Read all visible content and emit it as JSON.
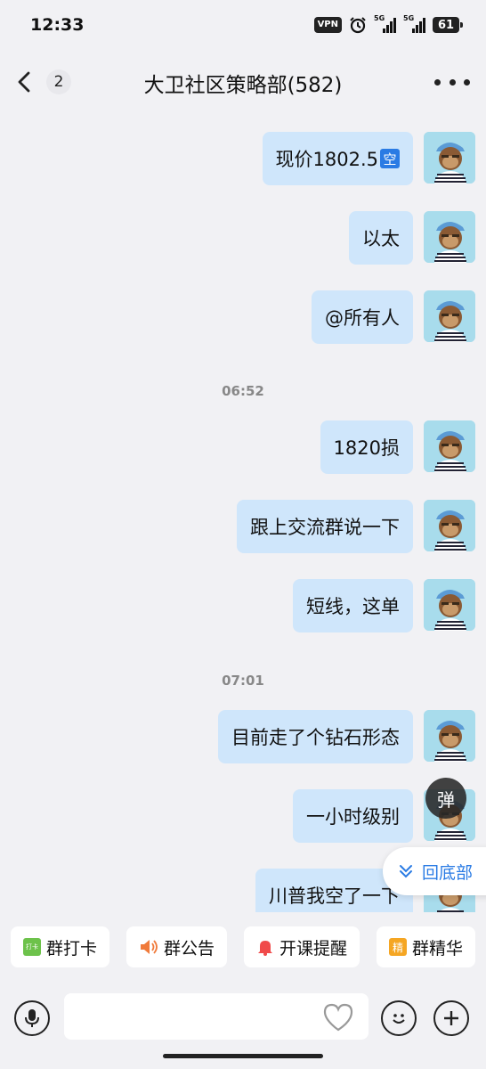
{
  "status": {
    "time": "12:33",
    "vpn": "VPN",
    "net1": "5G",
    "net2": "5G",
    "battery": "61"
  },
  "header": {
    "unread": "2",
    "title": "大卫社区策略部(582)"
  },
  "messages": [
    {
      "text": "现价1802.5",
      "tag": "空"
    },
    {
      "text": "以太"
    },
    {
      "text": "@所有人"
    },
    {
      "text": "1820损"
    },
    {
      "text": "跟上交流群说一下"
    },
    {
      "text": "短线，这单"
    },
    {
      "text": "目前走了个钻石形态"
    },
    {
      "text": "一小时级别"
    },
    {
      "text": "川普我空了一下"
    }
  ],
  "time_separators": [
    "06:52",
    "07:01"
  ],
  "floating": {
    "dan": "弹",
    "to_bottom": "回底部"
  },
  "quick_actions": [
    {
      "label": "群打卡",
      "icon": "打卡",
      "color": "#6dc24b"
    },
    {
      "label": "群公告",
      "icon": "",
      "color": "#f07a3a"
    },
    {
      "label": "开课提醒",
      "icon": "",
      "color": "#f04a4a"
    },
    {
      "label": "群精华",
      "icon": "精",
      "color": "#f5a623"
    }
  ],
  "input": {
    "placeholder": ""
  }
}
